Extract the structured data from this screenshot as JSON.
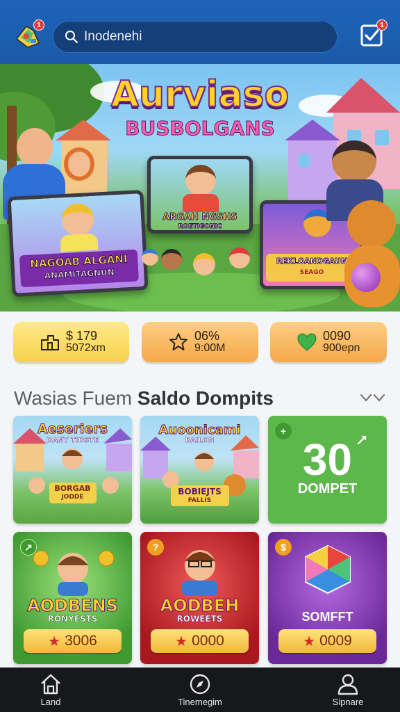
{
  "header": {
    "logo_badge": "1",
    "search_placeholder": "Inodenehi",
    "tasks_badge": "1"
  },
  "hero": {
    "title": "Aurviaso",
    "subtitle": "BUSBOLGANS",
    "screen_left_label": "NAGOAB ALGANI",
    "screen_left_sub": "ANAMITAGNUN",
    "screen_center_label": "ARGAH NGSHS",
    "screen_center_sub": "ROETIGONIC",
    "screen_right_label": "REKLOANDGAUN",
    "screen_right_sub": "SEAGO"
  },
  "stats": [
    {
      "value": "$ 179",
      "sub": "5072xm",
      "icon": "wallet-icon"
    },
    {
      "value": "06%",
      "sub": "9:00M",
      "icon": "star-icon"
    },
    {
      "value": "0090",
      "sub": "900epn",
      "icon": "heart-icon"
    }
  ],
  "section": {
    "title_light": "Wasias Fuem",
    "title_bold": "Saldo Dompits"
  },
  "cards": [
    {
      "title": "Aeseriers",
      "subtitle": "DANY TIOSTE",
      "banner": "BORGAB",
      "banner_sub": "JODDE"
    },
    {
      "title": "Auoonicami",
      "subtitle": "BAILON",
      "banner": "BOBIEJTS",
      "banner_sub": "FALLIS"
    },
    {
      "big": "30",
      "label": "DOMPET",
      "badge": "+"
    },
    {
      "title": "AODBENS",
      "subtitle": "RONYESTS",
      "price": "3006",
      "badge": "↗"
    },
    {
      "title": "AODBEH",
      "subtitle": "ROWEETS",
      "price": "0000",
      "badge": "?"
    },
    {
      "title": "SOMFFT",
      "price": "0009",
      "badge": "$"
    }
  ],
  "nav": [
    {
      "label": "Land",
      "icon": "home-icon"
    },
    {
      "label": "Tinemegim",
      "icon": "compass-icon"
    },
    {
      "label": "Sipnare",
      "icon": "profile-icon"
    }
  ],
  "colors": {
    "header": "#1e63b8",
    "nav": "#17181c",
    "card_green": "#5cb84a",
    "card_red": "#c9262e",
    "card_purple": "#8a3ac0"
  }
}
